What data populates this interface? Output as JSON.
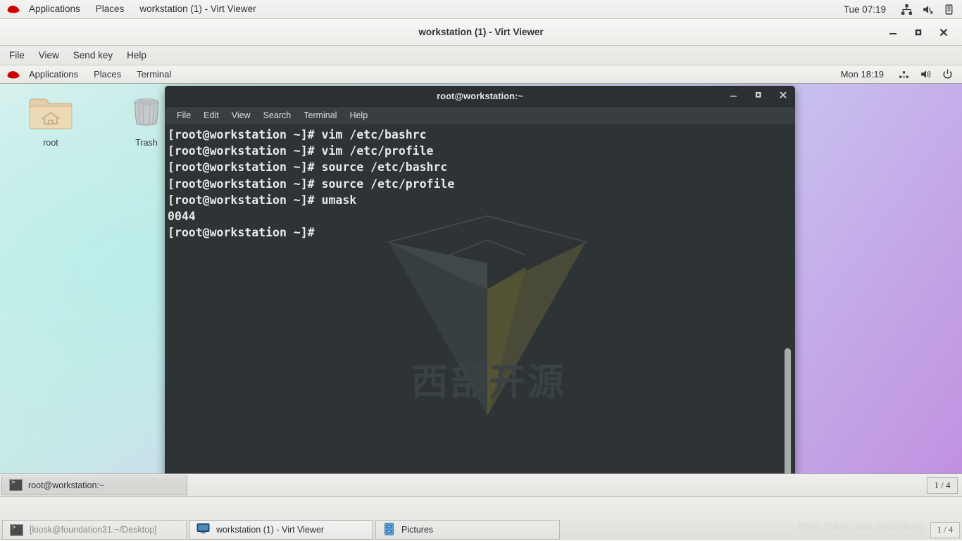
{
  "host_panel": {
    "logo": "redhat-logo-icon",
    "menus": [
      "Applications",
      "Places"
    ],
    "window_title": "workstation (1) - Virt Viewer",
    "clock": "Tue 07:19",
    "tray": [
      "network-icon",
      "volume-muted-icon",
      "battery-icon"
    ]
  },
  "virt_viewer": {
    "title": "workstation (1) - Virt Viewer",
    "window_buttons": [
      "minimize-icon",
      "maximize-icon",
      "close-icon"
    ],
    "menus": [
      "File",
      "View",
      "Send key",
      "Help"
    ]
  },
  "guest_panel": {
    "logo": "redhat-logo-icon",
    "menus": [
      "Applications",
      "Places",
      "Terminal"
    ],
    "clock": "Mon 18:19",
    "tray": [
      "network-icon",
      "volume-icon",
      "power-icon"
    ]
  },
  "desktop": {
    "icons": [
      {
        "name": "root",
        "icon": "home-folder-icon"
      },
      {
        "name": "Trash",
        "icon": "trash-icon"
      }
    ]
  },
  "terminal": {
    "title": "root@workstation:~",
    "window_buttons": [
      "minimize-icon",
      "maximize-icon",
      "close-icon"
    ],
    "menus": [
      "File",
      "Edit",
      "View",
      "Search",
      "Terminal",
      "Help"
    ],
    "lines": [
      "[root@workstation ~]# vim /etc/bashrc",
      "[root@workstation ~]# vim /etc/profile",
      "[root@workstation ~]# source /etc/bashrc",
      "[root@workstation ~]# source /etc/profile",
      "[root@workstation ~]# umask",
      "0044",
      "[root@workstation ~]#"
    ],
    "watermark_text": "西部开源",
    "bg_color": "#2e3436",
    "fg_color": "#e8eaea"
  },
  "guest_taskbar": {
    "tasks": [
      {
        "label": "root@workstation:~",
        "icon": "terminal-icon"
      }
    ],
    "workspace": "1 / 4"
  },
  "host_taskbar": {
    "tasks": [
      {
        "label": "[kiosk@foundation31:~/Desktop]",
        "icon": "terminal-icon",
        "state": "minimized"
      },
      {
        "label": "workstation (1) - Virt Viewer",
        "icon": "display-icon",
        "state": "active"
      },
      {
        "label": "Pictures",
        "icon": "folder-icon",
        "state": "normal"
      }
    ],
    "workspace": "1 / 4",
    "watermark": "https://blog.csdn.net/chitung"
  }
}
